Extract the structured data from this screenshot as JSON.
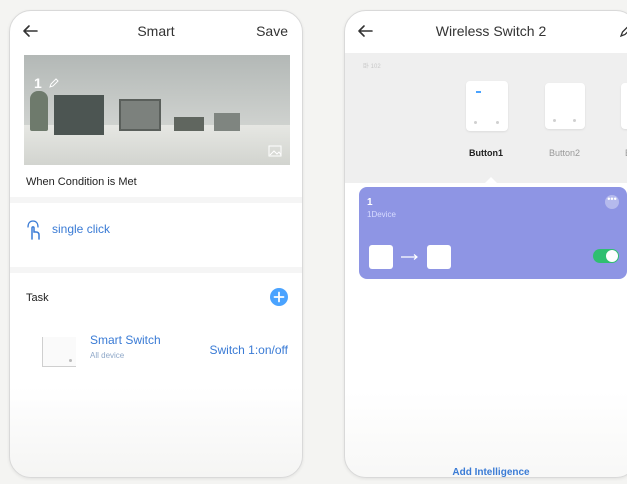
{
  "left_screen": {
    "header": {
      "title": "Smart",
      "save_label": "Save"
    },
    "scene": {
      "name": "1"
    },
    "condition": {
      "title": "When Condition is Met",
      "trigger": "single click"
    },
    "task": {
      "title": "Task",
      "device_name": "Smart Switch",
      "device_sub": "All device",
      "action": "Switch 1:on/off"
    }
  },
  "right_screen": {
    "header": {
      "title": "Wireless Switch 2"
    },
    "room_label": "卧 102",
    "buttons": [
      {
        "label": "Button1"
      },
      {
        "label": "Button2"
      },
      {
        "label": "B"
      }
    ],
    "scene_card": {
      "number": "1",
      "devices": "1Device",
      "more": "•••",
      "toggle_on": true
    },
    "footer": {
      "add_label": "Add Intelligence"
    }
  },
  "colors": {
    "accent_blue": "#3a7bd5",
    "card_purple": "#8e95e4",
    "toggle_green": "#2fbf71",
    "add_button_blue": "#4aa3ff"
  }
}
